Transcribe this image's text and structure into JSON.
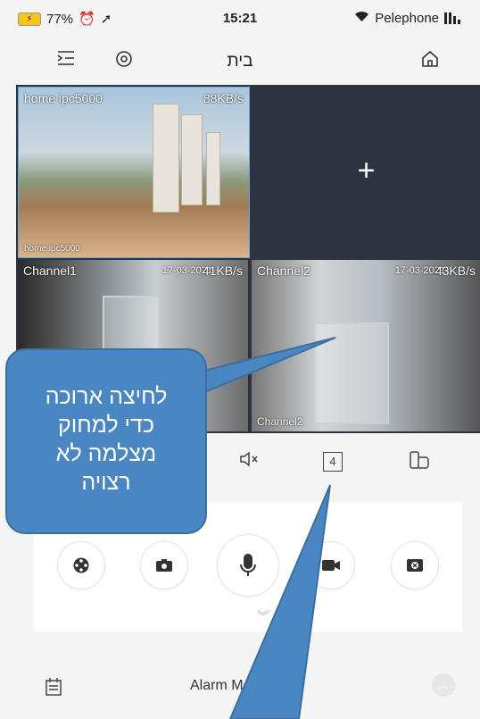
{
  "status_bar": {
    "battery": "77%",
    "time": "15:21",
    "carrier": "Pelephone"
  },
  "nav": {
    "title": "בית",
    "icons": [
      "expand-menu-icon",
      "settings-icon",
      "home-icon"
    ]
  },
  "channels": [
    {
      "name": "home ipc5000",
      "rate": "88KB/s",
      "overlay": "home ipc5000"
    },
    {
      "name": "add",
      "plus": "+"
    },
    {
      "name": "Channel1",
      "rate": "41KB/s",
      "date": "17-03-2021"
    },
    {
      "name": "Channel2",
      "rate": "43KB/s",
      "date": "17-03-2021",
      "overlay": "Channel2"
    }
  ],
  "controls": {
    "mute_icon": "mute-icon",
    "layout_label": "4",
    "fullscreen_icon": "rotate-icon"
  },
  "actions": [
    "ptz-icon",
    "snapshot-icon",
    "microphone-icon",
    "record-icon",
    "close-icon"
  ],
  "bottom": {
    "alarm_label": "Alarm Message"
  },
  "callout": {
    "lines": [
      "לחיצה ארוכה",
      "כדי למחוק",
      "מצלמה לא",
      "רצויה"
    ]
  },
  "colors": {
    "callout": "#4a86c2",
    "grid_bg": "#2b3440"
  }
}
